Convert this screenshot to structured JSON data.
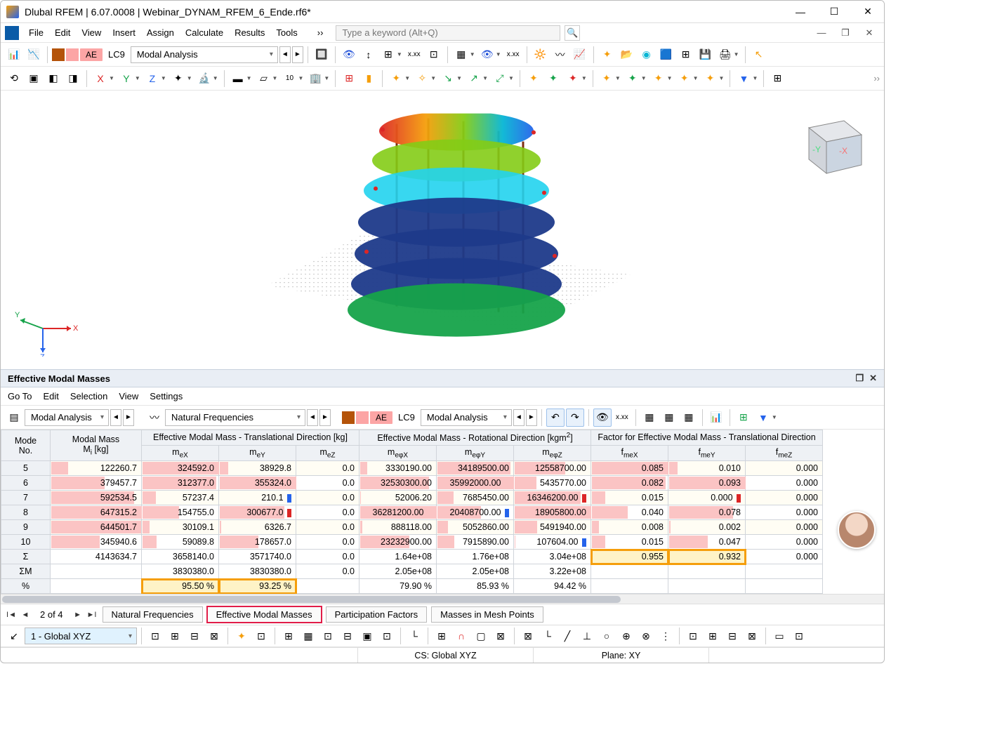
{
  "window": {
    "title": "Dlubal RFEM | 6.07.0008 | Webinar_DYNAM_RFEM_6_Ende.rf6*"
  },
  "menu": {
    "items": [
      "File",
      "Edit",
      "View",
      "Insert",
      "Assign",
      "Calculate",
      "Results",
      "Tools"
    ],
    "more": "››",
    "search_placeholder": "Type a keyword (Alt+Q)"
  },
  "toolbar1": {
    "lc_label": "LC9",
    "analysis_dropdown": "Modal Analysis",
    "ae_label": "AE"
  },
  "panel": {
    "title": "Effective Modal Masses",
    "menu": [
      "Go To",
      "Edit",
      "Selection",
      "View",
      "Settings"
    ],
    "dd1": "Modal Analysis",
    "dd2": "Natural Frequencies",
    "lc_label": "LC9",
    "dd3": "Modal Analysis",
    "ae_label": "AE"
  },
  "table": {
    "group_headers": {
      "mode": "Mode\nNo.",
      "modal_mass": "Modal Mass\nMᵢ [kg]",
      "trans": "Effective Modal Mass - Translational Direction [kg]",
      "rot": "Effective Modal Mass - Rotational Direction [kgm²]",
      "factor": "Factor for Effective Modal Mass - Translational Direction"
    },
    "sub_headers": {
      "mex": "mₑX",
      "mey": "mₑY",
      "mez": "mₑZ",
      "mphx": "mₑφX",
      "mphy": "mₑφY",
      "mphz": "mₑφZ",
      "fmex": "fₘₑX",
      "fmey": "fₘₑY",
      "fmez": "fₘₑZ"
    },
    "rows": [
      {
        "mode": "5",
        "mi": "122260.7",
        "mex": "324592.0",
        "mey": "38929.8",
        "mez": "0.0",
        "mphx": "3330190.00",
        "mphy": "34189500.00",
        "mphz": "12558700.00",
        "fmex": "0.085",
        "fmey": "0.010",
        "fmez": "0.000"
      },
      {
        "mode": "6",
        "mi": "379457.7",
        "mex": "312377.0",
        "mey": "355324.0",
        "mez": "0.0",
        "mphx": "32530300.00",
        "mphy": "35992000.00",
        "mphz": "5435770.00",
        "fmex": "0.082",
        "fmey": "0.093",
        "fmez": "0.000"
      },
      {
        "mode": "7",
        "mi": "592534.5",
        "mex": "57237.4",
        "mey": "210.1",
        "mez": "0.0",
        "mphx": "52006.20",
        "mphy": "7685450.00",
        "mphz": "16346200.00",
        "fmex": "0.015",
        "fmey": "0.000",
        "fmez": "0.000"
      },
      {
        "mode": "8",
        "mi": "647315.2",
        "mex": "154755.0",
        "mey": "300677.0",
        "mez": "0.0",
        "mphx": "36281200.00",
        "mphy": "20408700.00",
        "mphz": "18905800.00",
        "fmex": "0.040",
        "fmey": "0.078",
        "fmez": "0.000"
      },
      {
        "mode": "9",
        "mi": "644501.7",
        "mex": "30109.1",
        "mey": "6326.7",
        "mez": "0.0",
        "mphx": "888118.00",
        "mphy": "5052860.00",
        "mphz": "5491940.00",
        "fmex": "0.008",
        "fmey": "0.002",
        "fmez": "0.000"
      },
      {
        "mode": "10",
        "mi": "345940.6",
        "mex": "59089.8",
        "mey": "178657.0",
        "mez": "0.0",
        "mphx": "23232900.00",
        "mphy": "7915890.00",
        "mphz": "107604.00",
        "fmex": "0.015",
        "fmey": "0.047",
        "fmez": "0.000"
      }
    ],
    "sum_row": {
      "mode": "Σ",
      "mi": "4143634.7",
      "mex": "3658140.0",
      "mey": "3571740.0",
      "mez": "0.0",
      "mphx": "1.64e+08",
      "mphy": "1.76e+08",
      "mphz": "3.04e+08",
      "fmex": "0.955",
      "fmey": "0.932",
      "fmez": "0.000"
    },
    "sigmaM_row": {
      "mode": "ΣM",
      "mi": "",
      "mex": "3830380.0",
      "mey": "3830380.0",
      "mez": "0.0",
      "mphx": "2.05e+08",
      "mphy": "2.05e+08",
      "mphz": "3.22e+08",
      "fmex": "",
      "fmey": "",
      "fmez": ""
    },
    "pct_row": {
      "mode": "%",
      "mi": "",
      "mex": "95.50 %",
      "mey": "93.25 %",
      "mez": "",
      "mphx": "79.90 %",
      "mphy": "85.93 %",
      "mphz": "94.42 %",
      "fmex": "",
      "fmey": "",
      "fmez": ""
    }
  },
  "tabs": {
    "page": "2 of 4",
    "items": [
      "Natural Frequencies",
      "Effective Modal Masses",
      "Participation Factors",
      "Masses in Mesh Points"
    ],
    "active_index": 1
  },
  "bottom": {
    "coord_dropdown": "1 - Global XYZ"
  },
  "status": {
    "cs": "CS: Global XYZ",
    "plane": "Plane: XY"
  }
}
